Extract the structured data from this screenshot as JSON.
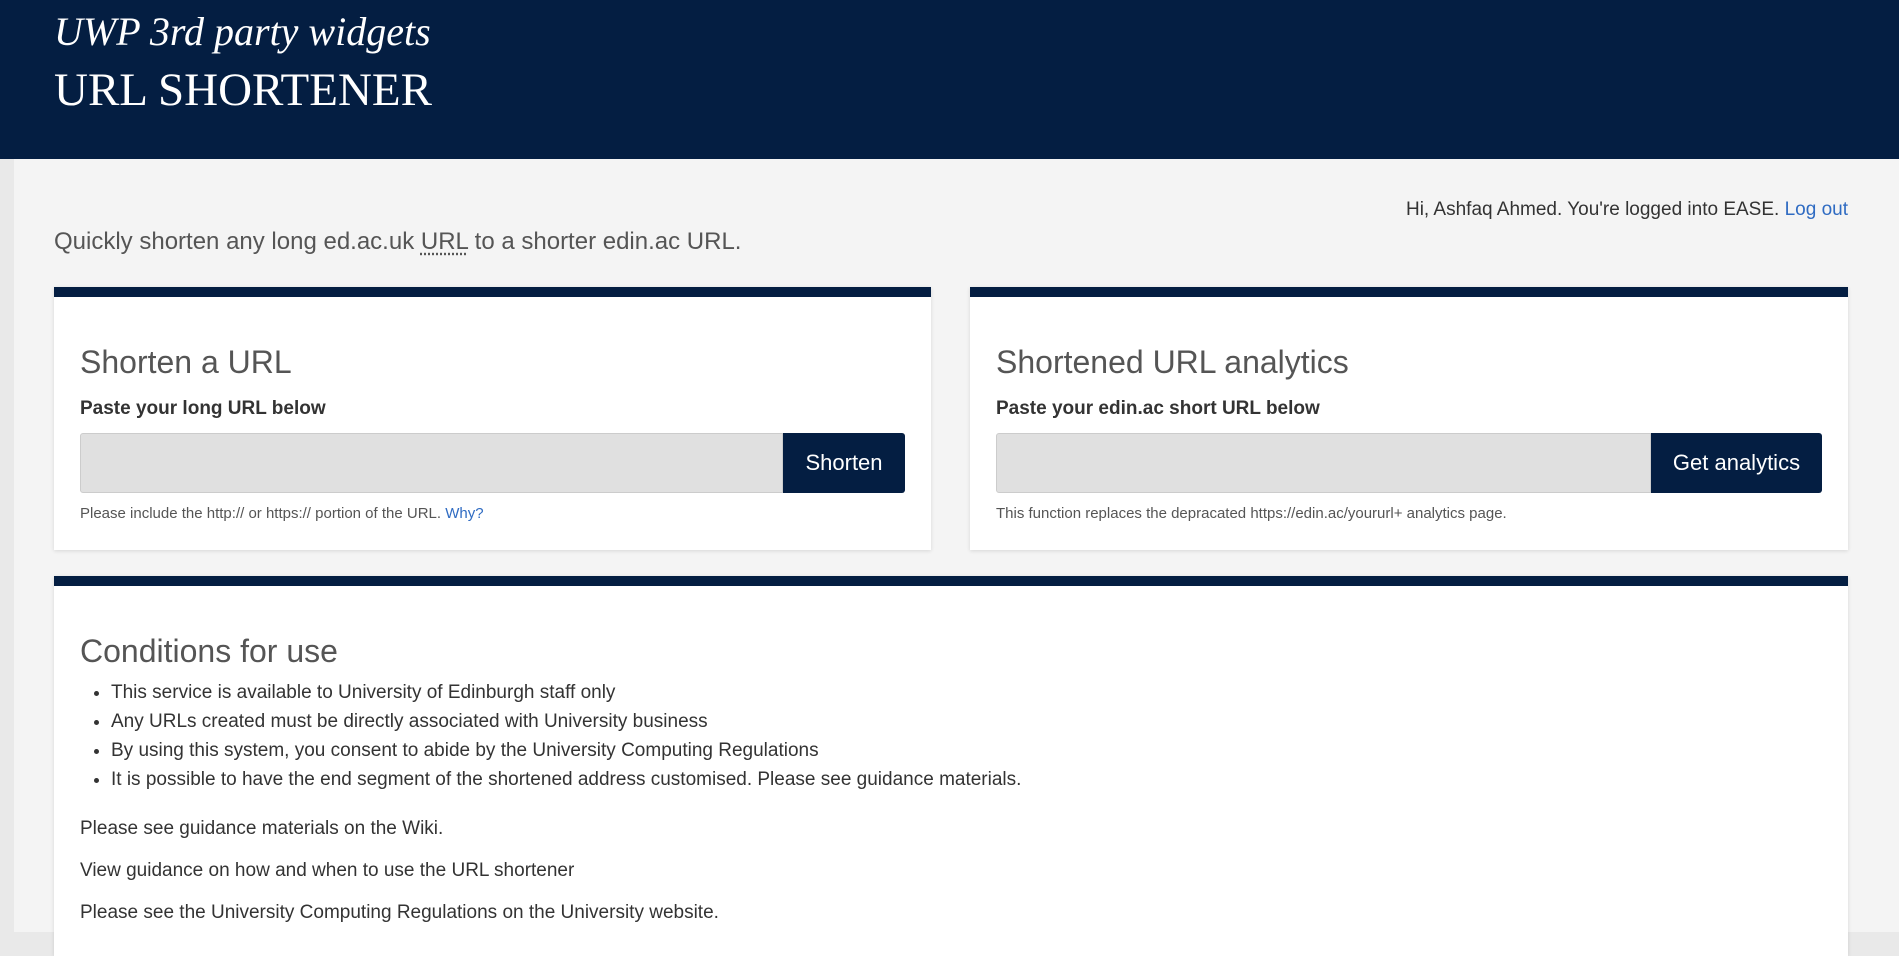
{
  "header": {
    "subtitle": "UWP 3rd party widgets",
    "title": "URL SHORTENER"
  },
  "session": {
    "greeting": "Hi, Ashfaq Ahmed. You're logged into EASE.",
    "logout_label": "Log out"
  },
  "intro": {
    "before": "Quickly shorten any long ed.ac.uk ",
    "abbr": "URL",
    "after": " to a shorter edin.ac URL."
  },
  "shorten_panel": {
    "heading": "Shorten a URL",
    "label": "Paste your long URL below",
    "input_value": "",
    "button_label": "Shorten",
    "help_text": "Please include the http:// or https:// portion of the URL. ",
    "help_link": "Why?"
  },
  "analytics_panel": {
    "heading": "Shortened URL analytics",
    "label": "Paste your edin.ac short URL below",
    "input_value": "",
    "button_label": "Get analytics",
    "help_text": "This function replaces the depracated https://edin.ac/yoururl+ analytics page."
  },
  "conditions": {
    "heading": "Conditions for use",
    "items": [
      "This service is available to University of Edinburgh staff only",
      "Any URLs created must be directly associated with University business",
      "By using this system, you consent to abide by the University Computing Regulations",
      "It is possible to have the end segment of the shortened address customised. Please see guidance materials."
    ],
    "wiki_text": "Please see guidance materials on the Wiki.",
    "guidance_link": "View guidance on how and when to use the URL shortener",
    "regulations_text": "Please see the University Computing Regulations on the University website."
  },
  "colors": {
    "header_bg": "#041e42",
    "link": "#2f6bc2",
    "page_bg": "#f4f4f4"
  }
}
